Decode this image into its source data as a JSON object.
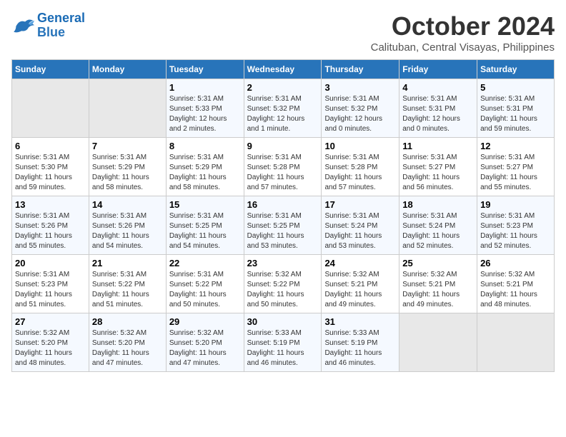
{
  "header": {
    "logo_line1": "General",
    "logo_line2": "Blue",
    "month": "October 2024",
    "location": "Calituban, Central Visayas, Philippines"
  },
  "days_of_week": [
    "Sunday",
    "Monday",
    "Tuesday",
    "Wednesday",
    "Thursday",
    "Friday",
    "Saturday"
  ],
  "weeks": [
    [
      {
        "day": "",
        "content": ""
      },
      {
        "day": "",
        "content": ""
      },
      {
        "day": "1",
        "content": "Sunrise: 5:31 AM\nSunset: 5:33 PM\nDaylight: 12 hours\nand 2 minutes."
      },
      {
        "day": "2",
        "content": "Sunrise: 5:31 AM\nSunset: 5:32 PM\nDaylight: 12 hours\nand 1 minute."
      },
      {
        "day": "3",
        "content": "Sunrise: 5:31 AM\nSunset: 5:32 PM\nDaylight: 12 hours\nand 0 minutes."
      },
      {
        "day": "4",
        "content": "Sunrise: 5:31 AM\nSunset: 5:31 PM\nDaylight: 12 hours\nand 0 minutes."
      },
      {
        "day": "5",
        "content": "Sunrise: 5:31 AM\nSunset: 5:31 PM\nDaylight: 11 hours\nand 59 minutes."
      }
    ],
    [
      {
        "day": "6",
        "content": "Sunrise: 5:31 AM\nSunset: 5:30 PM\nDaylight: 11 hours\nand 59 minutes."
      },
      {
        "day": "7",
        "content": "Sunrise: 5:31 AM\nSunset: 5:29 PM\nDaylight: 11 hours\nand 58 minutes."
      },
      {
        "day": "8",
        "content": "Sunrise: 5:31 AM\nSunset: 5:29 PM\nDaylight: 11 hours\nand 58 minutes."
      },
      {
        "day": "9",
        "content": "Sunrise: 5:31 AM\nSunset: 5:28 PM\nDaylight: 11 hours\nand 57 minutes."
      },
      {
        "day": "10",
        "content": "Sunrise: 5:31 AM\nSunset: 5:28 PM\nDaylight: 11 hours\nand 57 minutes."
      },
      {
        "day": "11",
        "content": "Sunrise: 5:31 AM\nSunset: 5:27 PM\nDaylight: 11 hours\nand 56 minutes."
      },
      {
        "day": "12",
        "content": "Sunrise: 5:31 AM\nSunset: 5:27 PM\nDaylight: 11 hours\nand 55 minutes."
      }
    ],
    [
      {
        "day": "13",
        "content": "Sunrise: 5:31 AM\nSunset: 5:26 PM\nDaylight: 11 hours\nand 55 minutes."
      },
      {
        "day": "14",
        "content": "Sunrise: 5:31 AM\nSunset: 5:26 PM\nDaylight: 11 hours\nand 54 minutes."
      },
      {
        "day": "15",
        "content": "Sunrise: 5:31 AM\nSunset: 5:25 PM\nDaylight: 11 hours\nand 54 minutes."
      },
      {
        "day": "16",
        "content": "Sunrise: 5:31 AM\nSunset: 5:25 PM\nDaylight: 11 hours\nand 53 minutes."
      },
      {
        "day": "17",
        "content": "Sunrise: 5:31 AM\nSunset: 5:24 PM\nDaylight: 11 hours\nand 53 minutes."
      },
      {
        "day": "18",
        "content": "Sunrise: 5:31 AM\nSunset: 5:24 PM\nDaylight: 11 hours\nand 52 minutes."
      },
      {
        "day": "19",
        "content": "Sunrise: 5:31 AM\nSunset: 5:23 PM\nDaylight: 11 hours\nand 52 minutes."
      }
    ],
    [
      {
        "day": "20",
        "content": "Sunrise: 5:31 AM\nSunset: 5:23 PM\nDaylight: 11 hours\nand 51 minutes."
      },
      {
        "day": "21",
        "content": "Sunrise: 5:31 AM\nSunset: 5:22 PM\nDaylight: 11 hours\nand 51 minutes."
      },
      {
        "day": "22",
        "content": "Sunrise: 5:31 AM\nSunset: 5:22 PM\nDaylight: 11 hours\nand 50 minutes."
      },
      {
        "day": "23",
        "content": "Sunrise: 5:32 AM\nSunset: 5:22 PM\nDaylight: 11 hours\nand 50 minutes."
      },
      {
        "day": "24",
        "content": "Sunrise: 5:32 AM\nSunset: 5:21 PM\nDaylight: 11 hours\nand 49 minutes."
      },
      {
        "day": "25",
        "content": "Sunrise: 5:32 AM\nSunset: 5:21 PM\nDaylight: 11 hours\nand 49 minutes."
      },
      {
        "day": "26",
        "content": "Sunrise: 5:32 AM\nSunset: 5:21 PM\nDaylight: 11 hours\nand 48 minutes."
      }
    ],
    [
      {
        "day": "27",
        "content": "Sunrise: 5:32 AM\nSunset: 5:20 PM\nDaylight: 11 hours\nand 48 minutes."
      },
      {
        "day": "28",
        "content": "Sunrise: 5:32 AM\nSunset: 5:20 PM\nDaylight: 11 hours\nand 47 minutes."
      },
      {
        "day": "29",
        "content": "Sunrise: 5:32 AM\nSunset: 5:20 PM\nDaylight: 11 hours\nand 47 minutes."
      },
      {
        "day": "30",
        "content": "Sunrise: 5:33 AM\nSunset: 5:19 PM\nDaylight: 11 hours\nand 46 minutes."
      },
      {
        "day": "31",
        "content": "Sunrise: 5:33 AM\nSunset: 5:19 PM\nDaylight: 11 hours\nand 46 minutes."
      },
      {
        "day": "",
        "content": ""
      },
      {
        "day": "",
        "content": ""
      }
    ]
  ]
}
